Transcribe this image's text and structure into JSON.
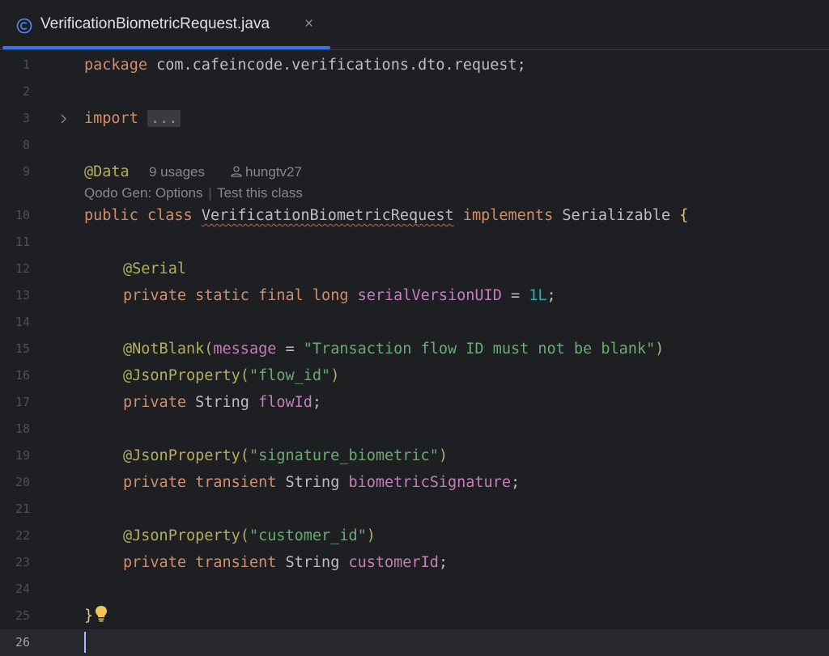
{
  "tab": {
    "icon": "class-icon",
    "title": "VerificationBiometricRequest.java",
    "close": "×"
  },
  "lines": {
    "l1": "1",
    "l2": "2",
    "l3": "3",
    "l8": "8",
    "l9": "9",
    "l10": "10",
    "l11": "11",
    "l12": "12",
    "l13": "13",
    "l14": "14",
    "l15": "15",
    "l16": "16",
    "l17": "17",
    "l18": "18",
    "l19": "19",
    "l20": "20",
    "l21": "21",
    "l22": "22",
    "l23": "23",
    "l24": "24",
    "l25": "25",
    "l26": "26"
  },
  "code": {
    "package_kw": "package",
    "package_name": " com.cafeincode.verifications.dto.request;",
    "import_kw": "import",
    "import_collapsed": "...",
    "data_ann": "@Data",
    "public_kw": "public",
    "class_kw": "class",
    "class_name": "VerificationBiometricRequest",
    "implements_kw": "implements",
    "interface_name": "Serializable",
    "open_brace": "{",
    "serial_ann": "@Serial",
    "private_kw": "private",
    "static_kw": "static",
    "final_kw": "final",
    "long_kw": "long",
    "serial_field": "serialVersionUID",
    "assign": " = ",
    "serial_value": "1L",
    "semicolon": ";",
    "notblank_ann": "@NotBlank",
    "open_paren": "(",
    "message_param": "message",
    "message_value": "\"Transaction flow ID must not be blank\"",
    "close_paren": ")",
    "json_ann": "@JsonProperty",
    "flow_id_str": "\"flow_id\"",
    "string_type": "String",
    "flow_field": "flowId",
    "sig_str": "\"signature_biometric\"",
    "transient_kw": "transient",
    "sig_field": "biometricSignature",
    "cust_str": "\"customer_id\"",
    "cust_field": "customerId",
    "close_brace": "}"
  },
  "hints": {
    "usages": "9 usages",
    "author": "hungtv27",
    "qodo_options": "Qodo Gen: Options",
    "separator": "|",
    "test_class": "Test this class"
  },
  "fold_icon": "chevron-right-icon",
  "intention_icon": "lightbulb-icon",
  "colors": {
    "background": "#1e1f22",
    "keyword": "#cf8e6d",
    "annotation": "#b3ae60",
    "string": "#6aab73",
    "field": "#c77dbb",
    "number": "#2aacb8",
    "accent": "#3574f0"
  }
}
